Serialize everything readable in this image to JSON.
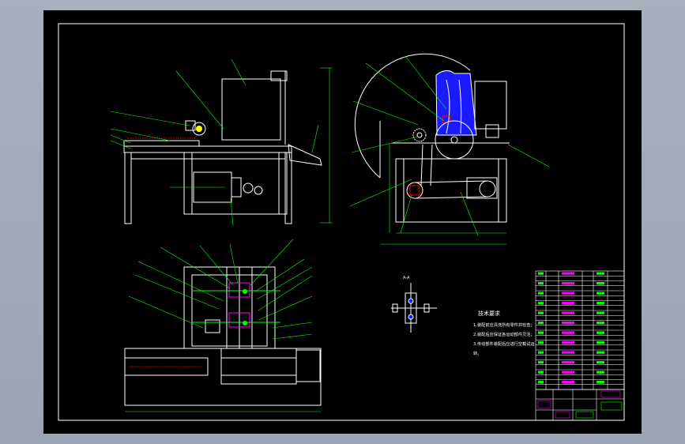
{
  "colors": {
    "viewport_bg": "#9aa4b2",
    "sheet_bg": "#000000",
    "line_white": "#ffffff",
    "line_green": "#00ff00",
    "fill_blue": "#1a1aff",
    "accent_red": "#ff0000",
    "accent_magenta": "#ff00ff",
    "accent_yellow": "#ffff00"
  },
  "drawing": {
    "section_label": "A-A",
    "notes": {
      "title": "技术要求",
      "lines": [
        "1.装配前应清洗所有零件并检查；",
        "2.装配后应保证各运动部件灵活；",
        "3.传动部件装配后应进行空载试运",
        "转。"
      ]
    }
  },
  "icons": {
    "front_view": "machine-front-view-icon",
    "side_view": "machine-side-view-icon",
    "plan_view": "machine-plan-view-icon",
    "detail": "gear-detail-icon"
  }
}
